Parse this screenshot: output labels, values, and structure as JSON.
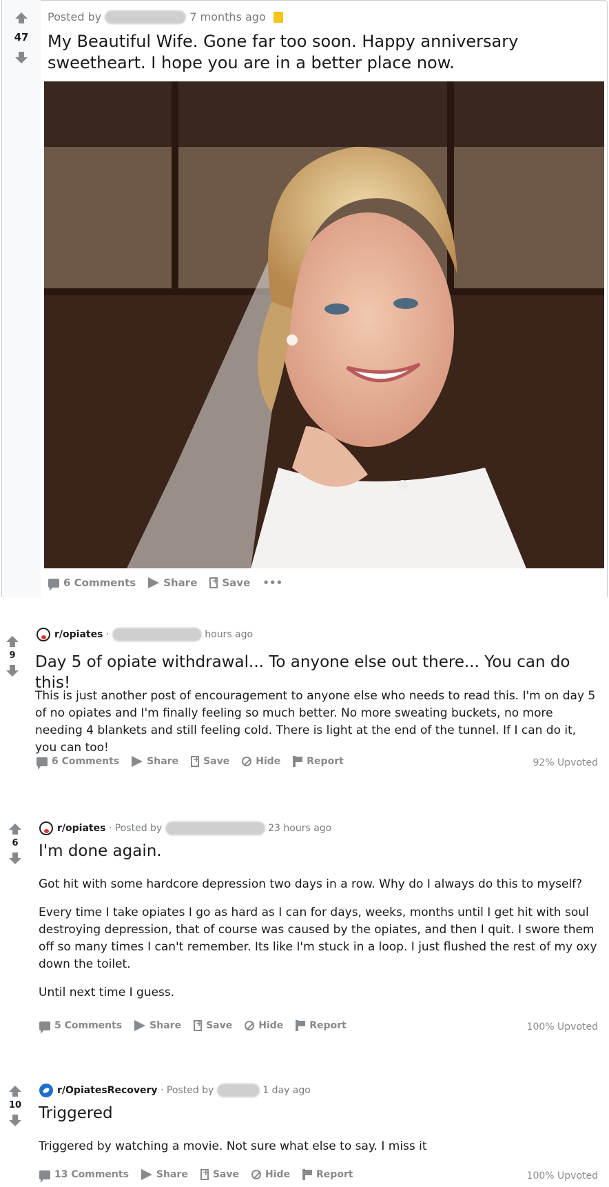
{
  "posts": [
    {
      "votes": "47",
      "posted_by_prefix": "Posted by",
      "time": "7 months ago",
      "title": "My Beautiful Wife. Gone far too soon. Happy anniversary sweetheart. I hope you are in a better place now.",
      "actions": {
        "comments": "6 Comments",
        "share": "Share",
        "save": "Save",
        "more": "•••"
      }
    },
    {
      "votes": "9",
      "subreddit": "r/opiates",
      "separator": "·",
      "time": "hours ago",
      "title": "Day 5 of opiate withdrawal... To anyone else out there... You can do this!",
      "body": [
        "This is just another post of encouragement to anyone else who needs to read this. I'm on day 5 of no opiates and I'm finally feeling so much better. No more sweating buckets, no more needing 4 blankets and still feeling cold. There is light at the end of the tunnel. If I can do it, you can too!"
      ],
      "actions": {
        "comments": "6 Comments",
        "share": "Share",
        "save": "Save",
        "hide": "Hide",
        "report": "Report"
      },
      "upvoted": "92% Upvoted"
    },
    {
      "votes": "6",
      "subreddit": "r/opiates",
      "separator": "·",
      "posted_by_prefix": "Posted by",
      "time": "23 hours ago",
      "title": "I'm done again.",
      "body": [
        "Got hit with some hardcore depression two days in a row. Why do I always do this to myself?",
        "Every time I take opiates I go as hard as I can for days, weeks, months until I get hit with soul destroying depression, that of course was caused by the opiates, and then I quit. I swore them off so many times I can't remember. Its like I'm stuck in a loop. I just flushed the rest of my oxy down the toilet.",
        "Until next time I guess."
      ],
      "actions": {
        "comments": "5 Comments",
        "share": "Share",
        "save": "Save",
        "hide": "Hide",
        "report": "Report"
      },
      "upvoted": "100% Upvoted"
    },
    {
      "votes": "10",
      "subreddit": "r/OpiatesRecovery",
      "separator": "·",
      "posted_by_prefix": "Posted by",
      "time": "1 day ago",
      "title": "Triggered",
      "body": [
        "Triggered by watching a movie. Not sure what else to say. I miss it"
      ],
      "actions": {
        "comments": "13 Comments",
        "share": "Share",
        "save": "Save",
        "hide": "Hide",
        "report": "Report"
      },
      "upvoted": "100% Upvoted"
    }
  ],
  "colors": {
    "meta": "#787c7e",
    "action": "#878a8c",
    "gold_icon": "#f5c518"
  }
}
